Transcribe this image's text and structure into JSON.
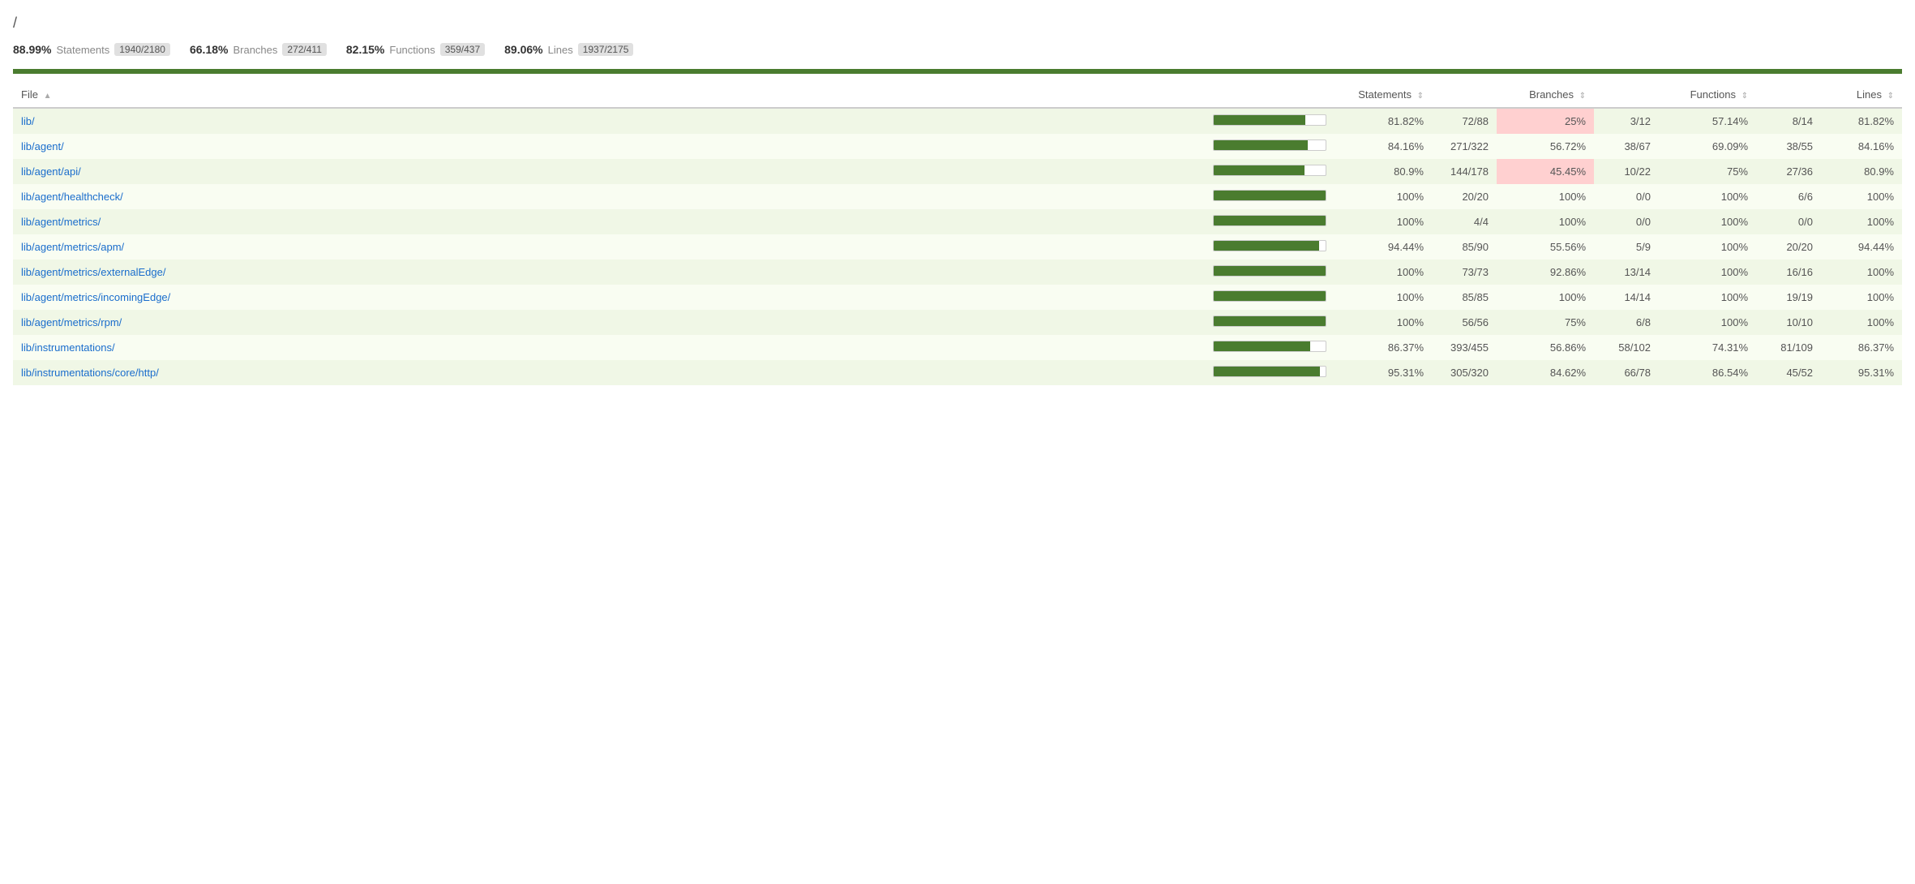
{
  "breadcrumb": "/",
  "summary": {
    "statements": {
      "pct": "88.99%",
      "label": "Statements",
      "badge": "1940/2180"
    },
    "branches": {
      "pct": "66.18%",
      "label": "Branches",
      "badge": "272/411"
    },
    "functions": {
      "pct": "82.15%",
      "label": "Functions",
      "badge": "359/437"
    },
    "lines": {
      "pct": "89.06%",
      "label": "Lines",
      "badge": "1937/2175"
    }
  },
  "table": {
    "headers": {
      "file": "File",
      "statements": "Statements",
      "branches": "Branches",
      "functions": "Functions",
      "lines": "Lines"
    },
    "rows": [
      {
        "file": "lib/",
        "bar_pct": 82,
        "stmt_pct": "81.82%",
        "stmt_num": "72/88",
        "br_pct": "25%",
        "br_num": "3/12",
        "br_low": true,
        "fn_pct": "57.14%",
        "fn_num": "8/14",
        "ln_pct": "81.82%"
      },
      {
        "file": "lib/agent/",
        "bar_pct": 84,
        "stmt_pct": "84.16%",
        "stmt_num": "271/322",
        "br_pct": "56.72%",
        "br_num": "38/67",
        "br_low": false,
        "fn_pct": "69.09%",
        "fn_num": "38/55",
        "ln_pct": "84.16%"
      },
      {
        "file": "lib/agent/api/",
        "bar_pct": 81,
        "stmt_pct": "80.9%",
        "stmt_num": "144/178",
        "br_pct": "45.45%",
        "br_num": "10/22",
        "br_low": true,
        "fn_pct": "75%",
        "fn_num": "27/36",
        "ln_pct": "80.9%"
      },
      {
        "file": "lib/agent/healthcheck/",
        "bar_pct": 100,
        "stmt_pct": "100%",
        "stmt_num": "20/20",
        "br_pct": "100%",
        "br_num": "0/0",
        "br_low": false,
        "fn_pct": "100%",
        "fn_num": "6/6",
        "ln_pct": "100%"
      },
      {
        "file": "lib/agent/metrics/",
        "bar_pct": 100,
        "stmt_pct": "100%",
        "stmt_num": "4/4",
        "br_pct": "100%",
        "br_num": "0/0",
        "br_low": false,
        "fn_pct": "100%",
        "fn_num": "0/0",
        "ln_pct": "100%"
      },
      {
        "file": "lib/agent/metrics/apm/",
        "bar_pct": 94,
        "stmt_pct": "94.44%",
        "stmt_num": "85/90",
        "br_pct": "55.56%",
        "br_num": "5/9",
        "br_low": false,
        "fn_pct": "100%",
        "fn_num": "20/20",
        "ln_pct": "94.44%"
      },
      {
        "file": "lib/agent/metrics/externalEdge/",
        "bar_pct": 100,
        "stmt_pct": "100%",
        "stmt_num": "73/73",
        "br_pct": "92.86%",
        "br_num": "13/14",
        "br_low": false,
        "fn_pct": "100%",
        "fn_num": "16/16",
        "ln_pct": "100%"
      },
      {
        "file": "lib/agent/metrics/incomingEdge/",
        "bar_pct": 100,
        "stmt_pct": "100%",
        "stmt_num": "85/85",
        "br_pct": "100%",
        "br_num": "14/14",
        "br_low": false,
        "fn_pct": "100%",
        "fn_num": "19/19",
        "ln_pct": "100%"
      },
      {
        "file": "lib/agent/metrics/rpm/",
        "bar_pct": 100,
        "stmt_pct": "100%",
        "stmt_num": "56/56",
        "br_pct": "75%",
        "br_num": "6/8",
        "br_low": false,
        "fn_pct": "100%",
        "fn_num": "10/10",
        "ln_pct": "100%"
      },
      {
        "file": "lib/instrumentations/",
        "bar_pct": 86,
        "stmt_pct": "86.37%",
        "stmt_num": "393/455",
        "br_pct": "56.86%",
        "br_num": "58/102",
        "br_low": false,
        "fn_pct": "74.31%",
        "fn_num": "81/109",
        "ln_pct": "86.37%"
      },
      {
        "file": "lib/instrumentations/core/http/",
        "bar_pct": 95,
        "stmt_pct": "95.31%",
        "stmt_num": "305/320",
        "br_pct": "84.62%",
        "br_num": "66/78",
        "br_low": false,
        "fn_pct": "86.54%",
        "fn_num": "45/52",
        "ln_pct": "95.31%"
      }
    ]
  }
}
